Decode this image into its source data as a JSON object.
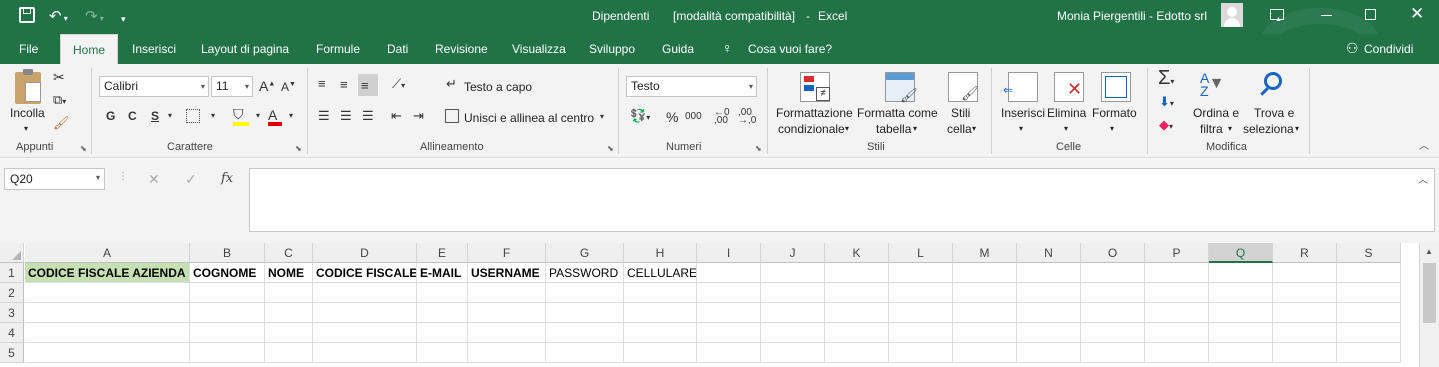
{
  "titlebar": {
    "doc_name": "Dipendenti",
    "mode": "[modalità compatibilità]",
    "separator": "-",
    "app": "Excel",
    "user": "Monia Piergentili - Edotto srl"
  },
  "ribbon_tabs": [
    "File",
    "Home",
    "Inserisci",
    "Layout di pagina",
    "Formule",
    "Dati",
    "Revisione",
    "Visualizza",
    "Sviluppo",
    "Guida"
  ],
  "tell_me": "Cosa vuoi fare?",
  "share": "Condividi",
  "home": {
    "paste_label": "Incolla",
    "font_name": "Calibri",
    "font_size": "11",
    "bold": "G",
    "italic": "C",
    "underline": "S",
    "wrap_text": "Testo a capo",
    "merge_center": "Unisci e allinea al centro",
    "number_format": "Testo",
    "percent": "%",
    "thousands": "000",
    "cond_format_1": "Formattazione",
    "cond_format_2": "condizionale",
    "format_table_1": "Formatta come",
    "format_table_2": "tabella",
    "cell_styles_1": "Stili",
    "cell_styles_2": "cella",
    "insert": "Inserisci",
    "delete": "Elimina",
    "format": "Formato",
    "sort_1": "Ordina e",
    "sort_2": "filtra",
    "find_1": "Trova e",
    "find_2": "seleziona",
    "groups": {
      "clipboard": "Appunti",
      "font": "Carattere",
      "alignment": "Allineamento",
      "number": "Numeri",
      "styles": "Stili",
      "cells": "Celle",
      "editing": "Modifica"
    }
  },
  "formula_bar": {
    "name_box": "Q20",
    "fx": "fx",
    "value": ""
  },
  "sheet": {
    "columns": [
      "A",
      "B",
      "C",
      "D",
      "E",
      "F",
      "G",
      "H",
      "I",
      "J",
      "K",
      "L",
      "M",
      "N",
      "O",
      "P",
      "Q",
      "R",
      "S"
    ],
    "selected_column": "Q",
    "rows": [
      "1",
      "2",
      "3",
      "4",
      "5"
    ],
    "row1": [
      "CODICE FISCALE AZIENDA",
      "COGNOME",
      "NOME",
      "CODICE FISCALE",
      "E-MAIL",
      "USERNAME",
      "PASSWORD",
      "CELLULARE"
    ]
  },
  "colors": {
    "excel_green": "#217346",
    "header_fill": "#c6e0b4"
  }
}
